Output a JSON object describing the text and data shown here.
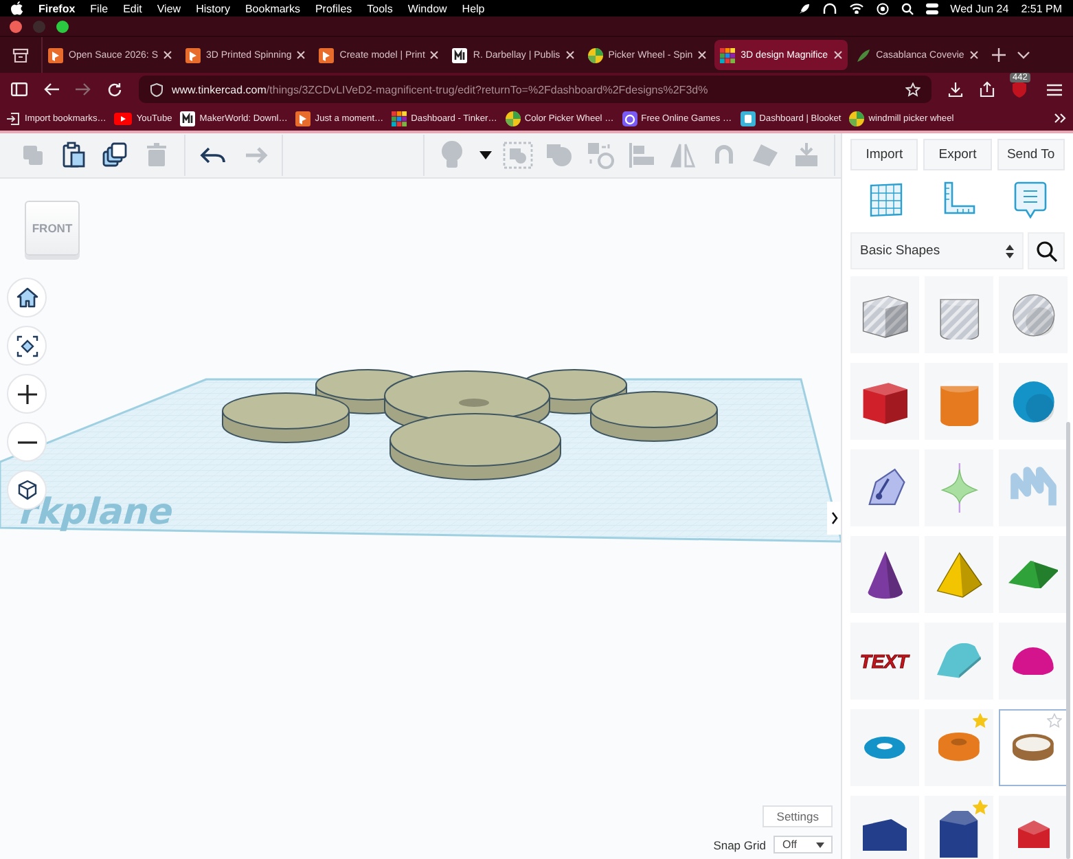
{
  "menubar": {
    "app": "Firefox",
    "menus": [
      "File",
      "Edit",
      "View",
      "History",
      "Bookmarks",
      "Profiles",
      "Tools",
      "Window",
      "Help"
    ],
    "date": "Wed Jun 24",
    "time": "2:51 PM"
  },
  "tabs": [
    {
      "title": "Open Sauce 2026: S",
      "kind": "printables",
      "selected": false
    },
    {
      "title": "3D Printed Spinning",
      "kind": "printables",
      "selected": false
    },
    {
      "title": "Create model | Print",
      "kind": "printables",
      "selected": false
    },
    {
      "title": "R. Darbellay | Publis",
      "kind": "makerworld",
      "selected": false
    },
    {
      "title": "Picker Wheel - Spin",
      "kind": "wheel",
      "selected": false
    },
    {
      "title": "3D design Magnifice",
      "kind": "tinkercad",
      "selected": true
    },
    {
      "title": "Casablanca Covevie",
      "kind": "leaf",
      "selected": false
    }
  ],
  "url": {
    "domain": "www.tinkercad.com",
    "path": "/things/3ZCDvLIVeD2-magnificent-trug/edit?returnTo=%2Fdashboard%2Fdesigns%2F3d%"
  },
  "extension_badge": "442",
  "bookmarks": [
    {
      "title": "Import bookmarks…",
      "kind": "import"
    },
    {
      "title": "YouTube",
      "kind": "youtube"
    },
    {
      "title": "MakerWorld: Downl…",
      "kind": "makerworld"
    },
    {
      "title": "Just a moment…",
      "kind": "printables"
    },
    {
      "title": "Dashboard - Tinker…",
      "kind": "tinkercad"
    },
    {
      "title": "Color Picker Wheel …",
      "kind": "wheel"
    },
    {
      "title": "Free Online Games …",
      "kind": "games"
    },
    {
      "title": "Dashboard | Blooket",
      "kind": "blooket"
    },
    {
      "title": "windmill picker wheel",
      "kind": "wheel"
    }
  ],
  "toolbar": {
    "edit_tools": [
      {
        "kind": "copy",
        "disabled": true
      },
      {
        "kind": "paste",
        "disabled": false
      },
      {
        "kind": "duplicate",
        "disabled": false
      },
      {
        "kind": "delete",
        "disabled": true
      }
    ],
    "history_tools": [
      {
        "kind": "undo",
        "disabled": false
      },
      {
        "kind": "redo",
        "disabled": true
      }
    ],
    "shape_tools": [
      {
        "kind": "bulb",
        "disabled": true
      },
      {
        "kind": "caret",
        "disabled": false
      },
      {
        "kind": "group",
        "disabled": true
      },
      {
        "kind": "union",
        "disabled": true
      },
      {
        "kind": "ungroup",
        "disabled": true
      },
      {
        "kind": "align",
        "disabled": true
      },
      {
        "kind": "mirror",
        "disabled": true
      },
      {
        "kind": "magnet",
        "disabled": true
      },
      {
        "kind": "plane",
        "disabled": true
      },
      {
        "kind": "drop",
        "disabled": true
      }
    ]
  },
  "canvas": {
    "viewcube": "FRONT",
    "workplane_label": "rkplane",
    "settings": "Settings",
    "snap_grid": {
      "label": "Snap Grid",
      "value": "Off"
    }
  },
  "panel": {
    "actions": [
      "Import",
      "Export",
      "Send To"
    ],
    "library": "Basic Shapes",
    "shapes": [
      {
        "kind": "box-hole",
        "color": "#c5c9d1",
        "starred": false,
        "selected": false
      },
      {
        "kind": "cylinder-hole",
        "color": "#c5c9d1",
        "starred": false,
        "selected": false
      },
      {
        "kind": "sphere-hole",
        "color": "#c5c9d1",
        "starred": false,
        "selected": false
      },
      {
        "kind": "box",
        "color": "#d0202a",
        "starred": false,
        "selected": false
      },
      {
        "kind": "cylinder",
        "color": "#e67a1e",
        "starred": false,
        "selected": false
      },
      {
        "kind": "sphere",
        "color": "#1493c9",
        "starred": false,
        "selected": false
      },
      {
        "kind": "scribble",
        "color": "#b3bcec",
        "starred": false,
        "selected": false
      },
      {
        "kind": "spinner",
        "color": "#a9dfa0",
        "starred": false,
        "selected": false
      },
      {
        "kind": "squiggle",
        "color": "#a9cbe6",
        "starred": false,
        "selected": false
      },
      {
        "kind": "cone",
        "color": "#7b3aa0",
        "starred": false,
        "selected": false
      },
      {
        "kind": "pyramid",
        "color": "#f2c500",
        "starred": false,
        "selected": false
      },
      {
        "kind": "roof",
        "color": "#2fa33a",
        "starred": false,
        "selected": false
      },
      {
        "kind": "text",
        "color": "#c4161c",
        "label": "TEXT",
        "starred": false,
        "selected": false
      },
      {
        "kind": "round-roof",
        "color": "#5bc2d0",
        "starred": false,
        "selected": false
      },
      {
        "kind": "half-sphere",
        "color": "#d4148c",
        "starred": false,
        "selected": false
      },
      {
        "kind": "torus",
        "color": "#1493c9",
        "starred": false,
        "selected": false
      },
      {
        "kind": "tube",
        "color": "#e67a1e",
        "starred": true,
        "selected": false
      },
      {
        "kind": "ring",
        "color": "#9a6a3a",
        "starred": false,
        "selected": true
      },
      {
        "kind": "wedge",
        "color": "#233e8b",
        "starred": false,
        "selected": false
      },
      {
        "kind": "hex-prism",
        "color": "#233e8b",
        "starred": true,
        "selected": false
      },
      {
        "kind": "polyhedron",
        "color": "#d0202a",
        "starred": false,
        "selected": false
      }
    ]
  }
}
